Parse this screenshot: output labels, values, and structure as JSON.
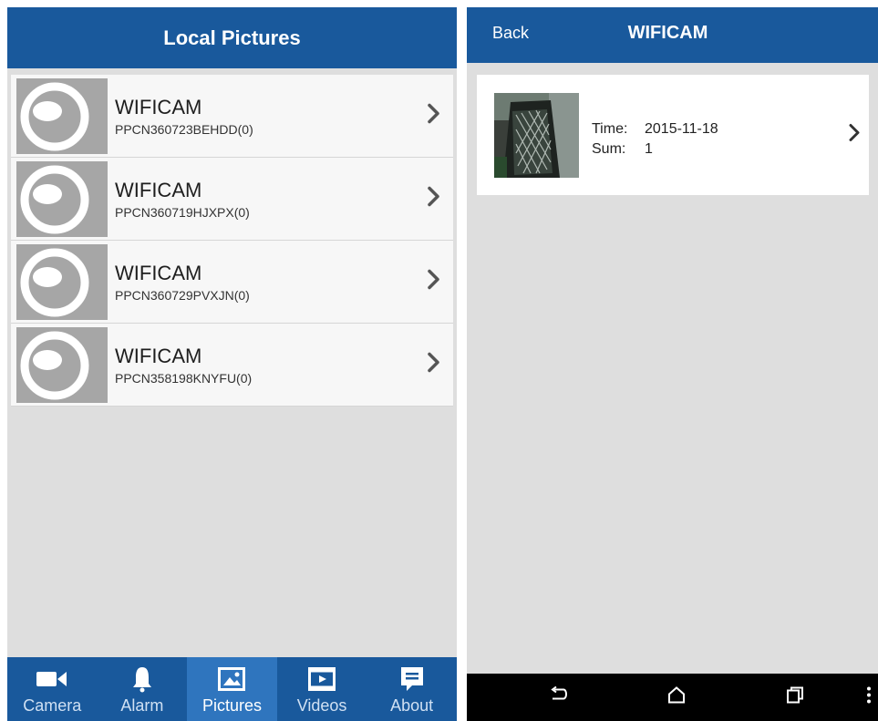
{
  "left_screen": {
    "title": "Local Pictures",
    "devices": [
      {
        "name": "WIFICAM",
        "id": "PPCN360723BEHDD(0)"
      },
      {
        "name": "WIFICAM",
        "id": "PPCN360719HJXPX(0)"
      },
      {
        "name": "WIFICAM",
        "id": "PPCN360729PVXJN(0)"
      },
      {
        "name": "WIFICAM",
        "id": "PPCN358198KNYFU(0)"
      }
    ],
    "tabs": [
      {
        "label": "Camera",
        "icon": "camera-icon"
      },
      {
        "label": "Alarm",
        "icon": "bell-icon"
      },
      {
        "label": "Pictures",
        "icon": "picture-icon",
        "active": true
      },
      {
        "label": "Videos",
        "icon": "video-icon"
      },
      {
        "label": "About",
        "icon": "info-icon"
      }
    ]
  },
  "right_screen": {
    "back_label": "Back",
    "title": "WIFICAM",
    "album": {
      "time_label": "Time:",
      "time_value": "2015-11-18",
      "sum_label": "Sum:",
      "sum_value": "1"
    },
    "nav": [
      "back-icon",
      "home-icon",
      "recent-apps-icon",
      "overflow-menu-icon"
    ]
  },
  "colors": {
    "header_blue": "#19599c",
    "active_tab_blue": "#2f75be",
    "background_gray": "#dedede"
  }
}
